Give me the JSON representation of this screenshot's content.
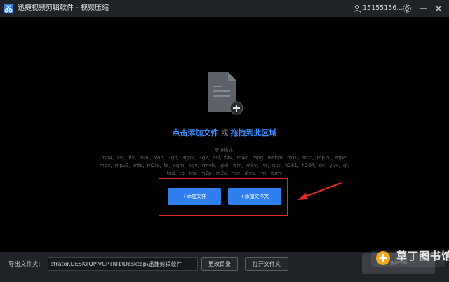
{
  "window": {
    "app_title": "迅捷视频剪辑软件 - 视频压缩",
    "user_name": "15155156...",
    "controls": [
      "settings",
      "minimize",
      "close"
    ]
  },
  "main": {
    "prompt_add": "点击添加文件",
    "prompt_or": "或",
    "prompt_drag": "拖拽到此区域",
    "formats_label": "支持格式:",
    "formats": "mp4, avi, flv, mov, vob, 3gp, 3gp2, 3g2, asf, f4v, m4v, mpg, webm, m1v, m2t, mp2v, mpe, mpv, mpv2, mts, m2ts, ts, ogm, ogv, rmvb, vp6, wm, mkv, ivr, nut, h261, h264, dv, yuv, qt, tod, tp, trp, m2p, m2v, nsv, divx, rm, wmv",
    "add_file_button": "+添加文件",
    "add_folder_button": "+添加文件夹"
  },
  "bottom": {
    "output_label": "导出文件夹:",
    "output_path": "strator.DESKTOP-VCPTI01\\Desktop\\迅捷剪辑软件",
    "change_dir_button": "更改目录",
    "open_folder_button": "打开文件夹",
    "start_button": "全部压缩"
  },
  "watermark": {
    "text": "草丁图书馆"
  },
  "colors": {
    "accent": "#2f7ff0",
    "highlight_box": "#e02a2a",
    "link_blue": "#3d8bff"
  }
}
